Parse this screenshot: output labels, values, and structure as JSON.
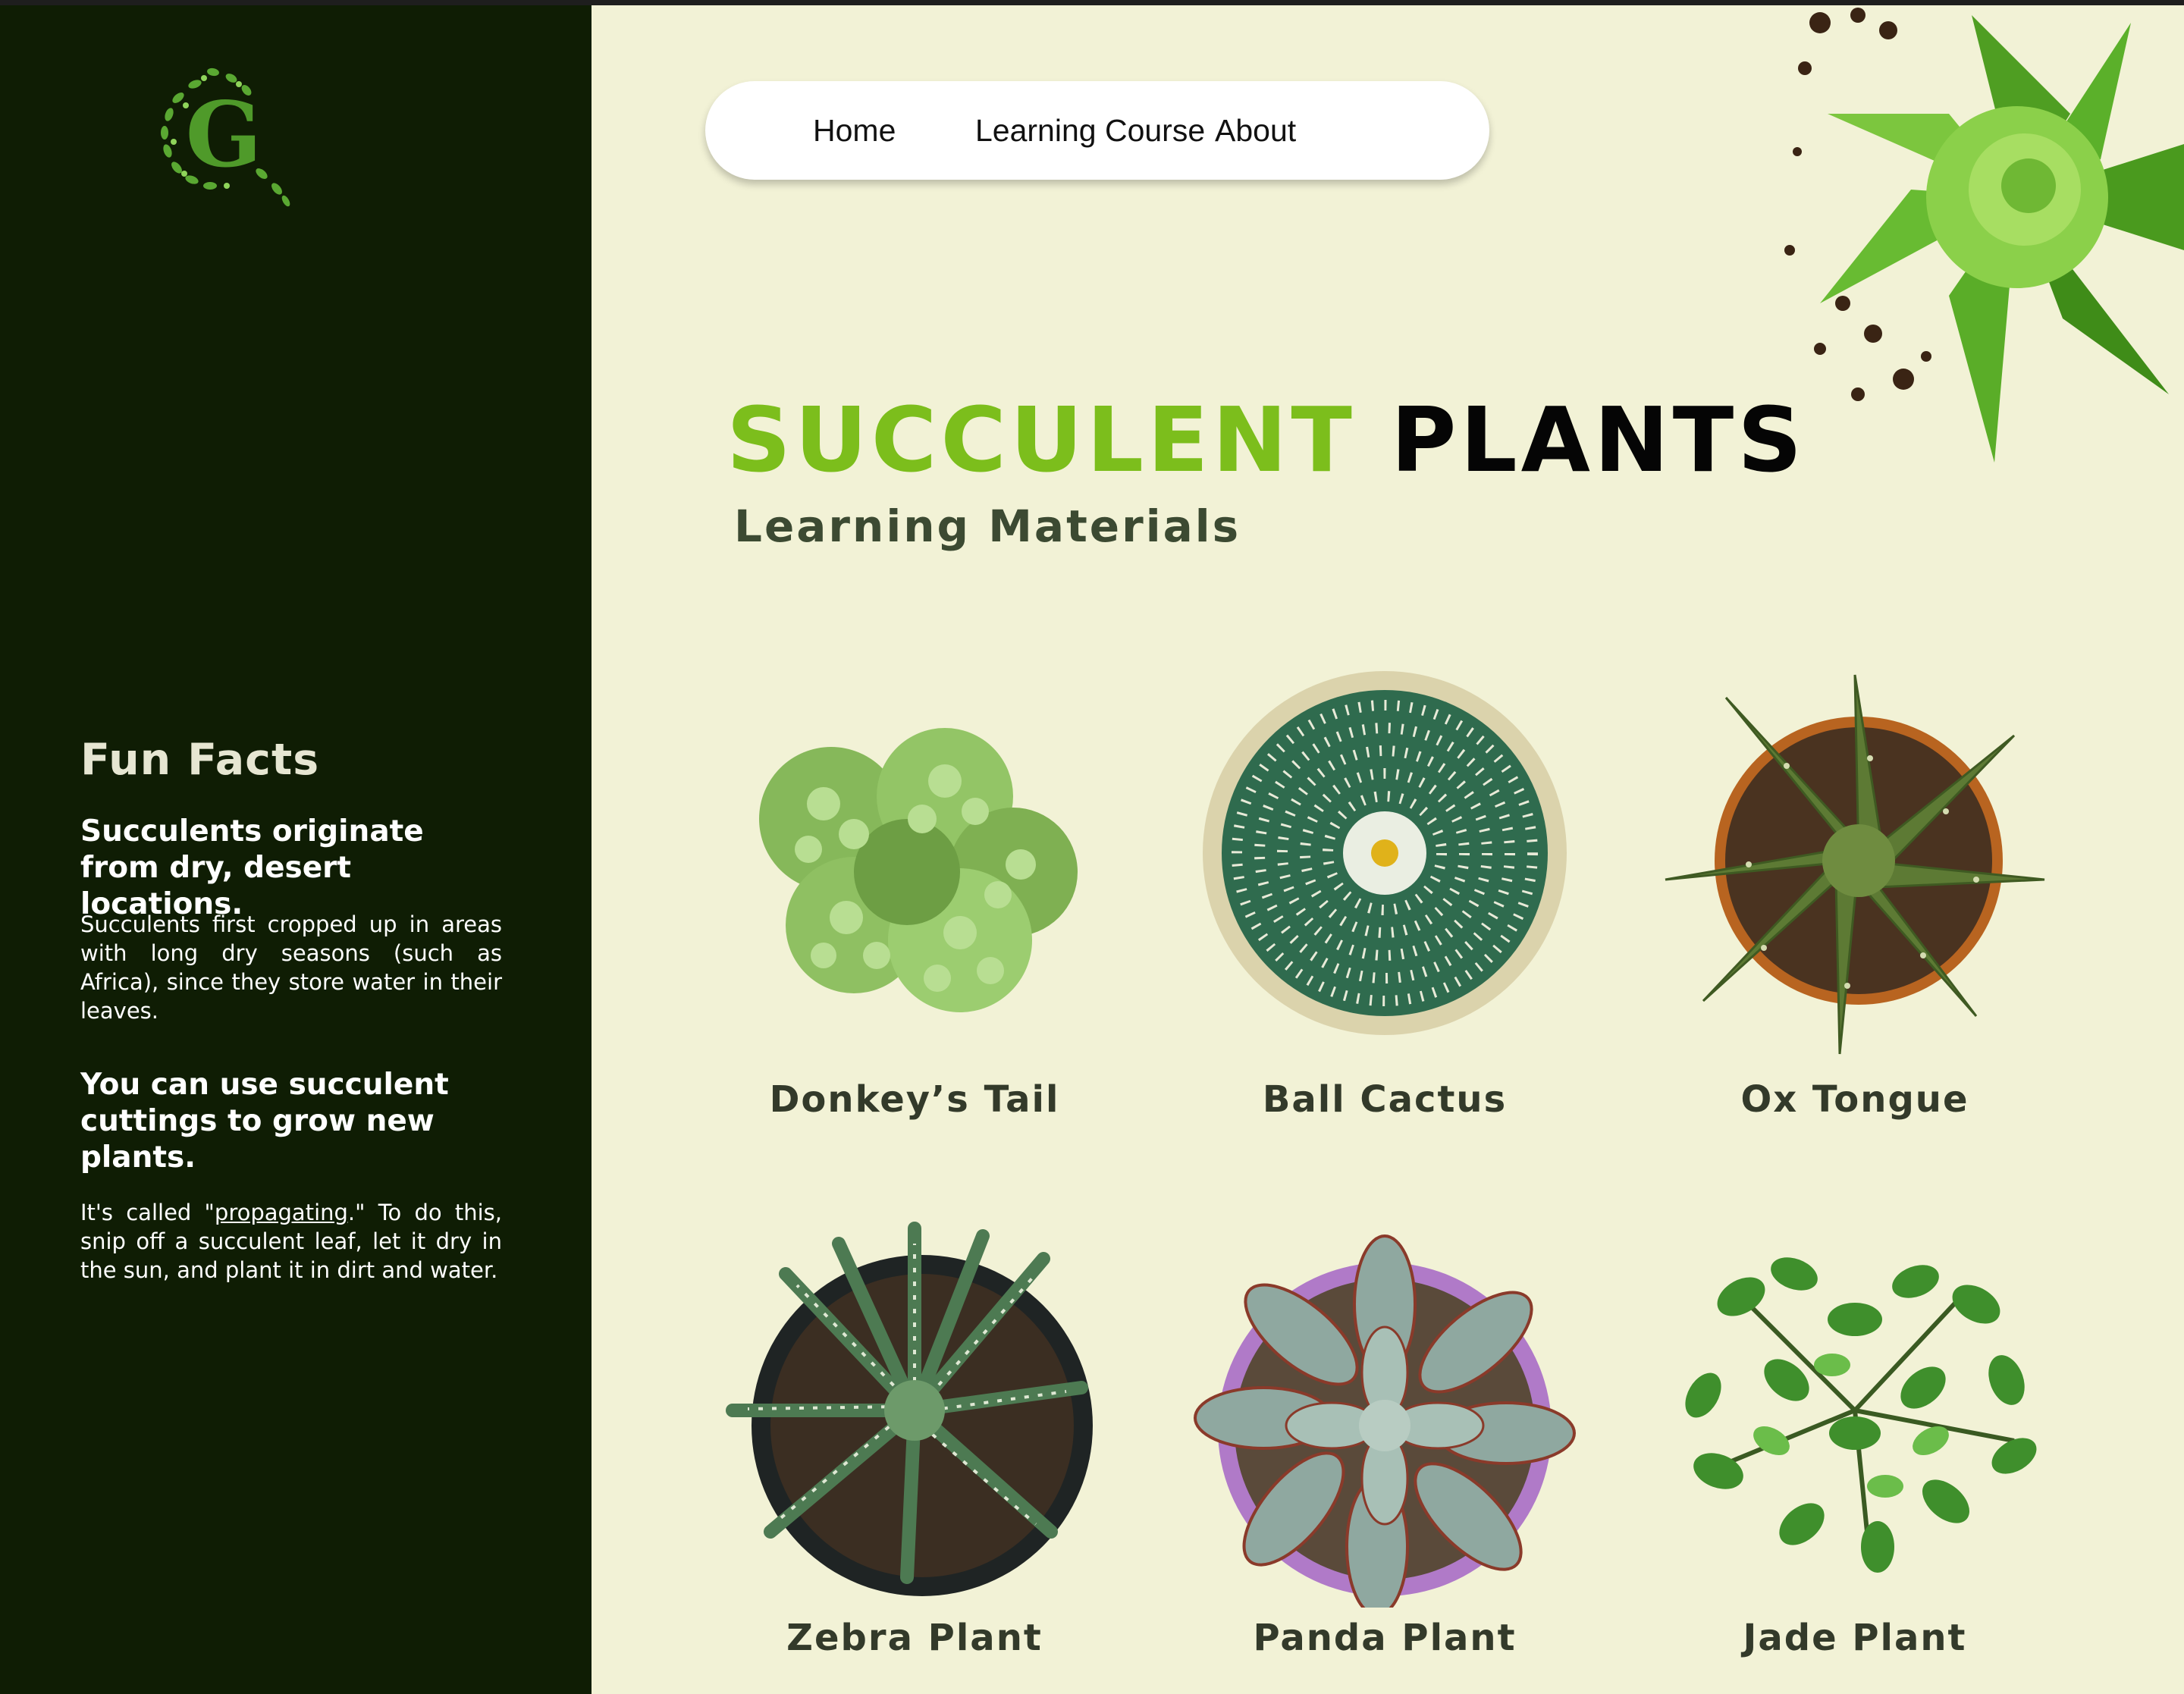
{
  "logo": {
    "letter": "G"
  },
  "nav": {
    "items": [
      {
        "label": "Home"
      },
      {
        "label": "Learning Course"
      },
      {
        "label": "About"
      }
    ]
  },
  "hero": {
    "title_accent": "SUCCULENT",
    "title_main": "PLANTS",
    "subtitle": "Learning Materials"
  },
  "sidebar": {
    "title": "Fun Facts",
    "facts": [
      {
        "heading": "Succulents originate from dry, desert locations.",
        "text": "Succulents first cropped up in areas with long dry seasons (such as Africa), since they store water in their leaves."
      },
      {
        "heading": "You can use succulent cuttings to grow new plants.",
        "text_before": "It's called \"",
        "link": "propagating",
        "text_after": ".\" To do this, snip off a succulent leaf, let it dry in the sun, and plant it in dirt and water."
      }
    ]
  },
  "plants": [
    {
      "name": "Donkey’s Tail",
      "icon": "donkeys-tail-image"
    },
    {
      "name": "Ball Cactus",
      "icon": "ball-cactus-image"
    },
    {
      "name": "Ox Tongue",
      "icon": "ox-tongue-image"
    },
    {
      "name": "Zebra Plant",
      "icon": "zebra-plant-image"
    },
    {
      "name": "Panda Plant",
      "icon": "panda-plant-image"
    },
    {
      "name": "Jade Plant",
      "icon": "jade-plant-image"
    }
  ],
  "colors": {
    "sidebar_bg": "#0f1d04",
    "page_bg": "#f2f2d6",
    "accent_green": "#7cbe1c",
    "label_text": "#333a2a"
  }
}
